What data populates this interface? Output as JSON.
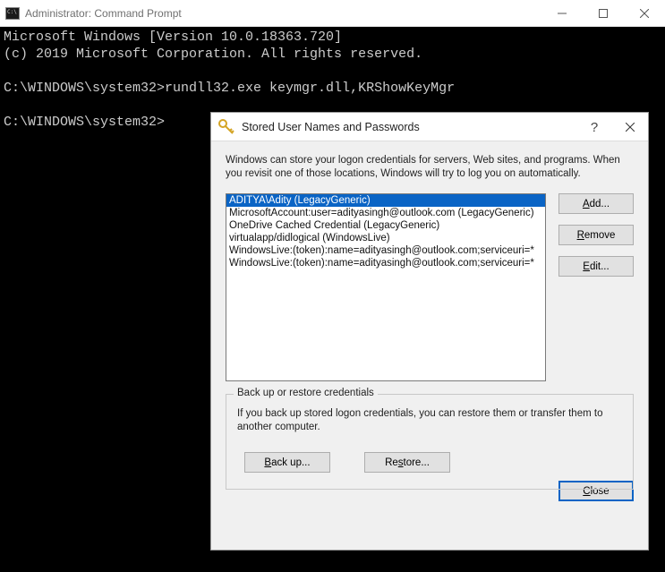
{
  "cmd": {
    "title": "Administrator: Command Prompt",
    "lines": [
      "Microsoft Windows [Version 10.0.18363.720]",
      "(c) 2019 Microsoft Corporation. All rights reserved.",
      "",
      "C:\\WINDOWS\\system32>rundll32.exe keymgr.dll,KRShowKeyMgr",
      "",
      "C:\\WINDOWS\\system32>"
    ]
  },
  "dialog": {
    "title": "Stored User Names and Passwords",
    "description": "Windows can store your logon credentials for servers, Web sites, and programs. When you revisit one of those locations, Windows will try to log you on automatically.",
    "credentials": [
      {
        "text": "ADITYA\\Adity (LegacyGeneric)",
        "selected": true
      },
      {
        "text": "MicrosoftAccount:user=adityasingh@outlook.com (LegacyGeneric)",
        "selected": false
      },
      {
        "text": "OneDrive Cached Credential (LegacyGeneric)",
        "selected": false
      },
      {
        "text": "virtualapp/didlogical (WindowsLive)",
        "selected": false
      },
      {
        "text": "WindowsLive:(token):name=adityasingh@outlook.com;serviceuri=*",
        "selected": false
      },
      {
        "text": "WindowsLive:(token):name=adityasingh@outlook.com;serviceuri=*",
        "selected": false
      }
    ],
    "buttons": {
      "add": "Add...",
      "remove": "Remove",
      "edit": "Edit...",
      "backup": "Back up...",
      "restore": "Restore...",
      "close": "Close"
    },
    "group": {
      "legend": "Back up or restore credentials",
      "desc": "If you back up stored logon credentials, you can restore them or transfer them to another computer."
    }
  }
}
